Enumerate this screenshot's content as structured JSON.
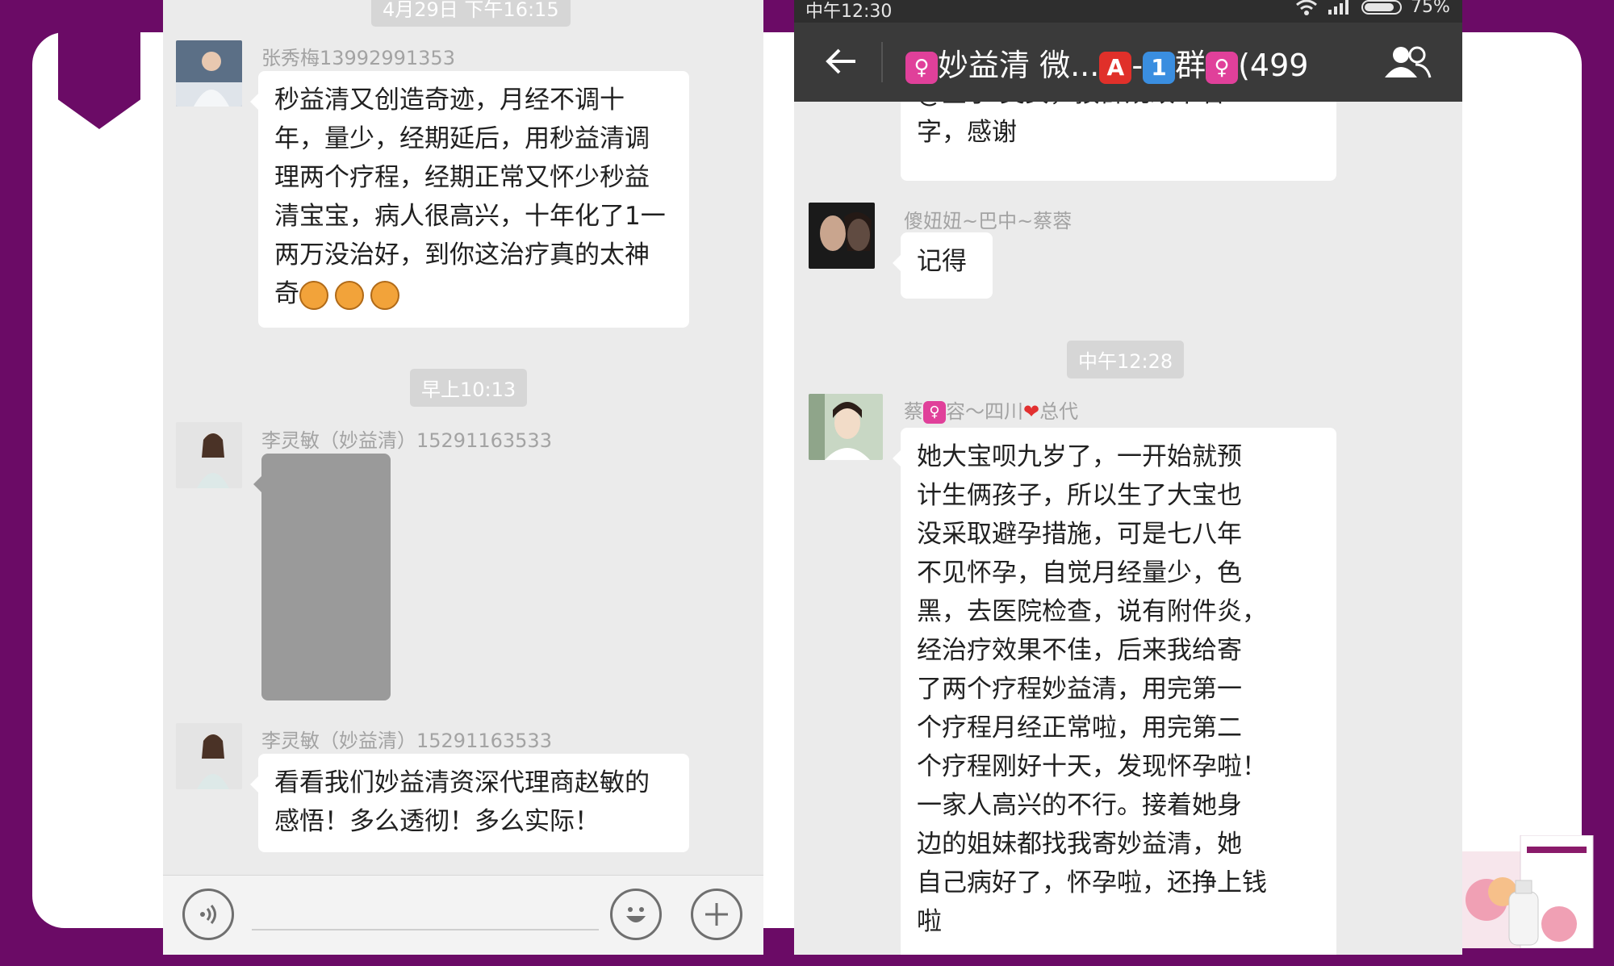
{
  "left_chat": {
    "top_timestamp": "4月29日 下午16:15",
    "messages": [
      {
        "sender": "张秀梅13992991353",
        "lines": [
          "秒益清又创造奇迹，月经不调十",
          "年，量少，经期延后，用秒益清调",
          "理两个疗程，经期正常又怀少秒益",
          "清宝宝，病人很高兴，十年化了1一",
          "两万没治好，到你这治疗真的太神",
          "奇"
        ]
      },
      {
        "timestamp": "早上10:13"
      },
      {
        "sender": "李灵敏（妙益清）15291163533",
        "type": "image"
      },
      {
        "sender": "李灵敏（妙益清）15291163533",
        "lines": [
          "看看我们妙益清资深代理商赵敏的",
          "感悟！多么透彻！多么实际！"
        ]
      }
    ],
    "input_bar": {
      "voice_icon": "voice-icon",
      "emoji_icon": "emoji-icon",
      "plus_icon": "plus-icon"
    }
  },
  "right_chat": {
    "status": {
      "time": "中午12:30",
      "battery": "75%"
    },
    "title": {
      "part1": "妙益清 微...",
      "tag_a": "A",
      "dash": "-",
      "tag_1": "1",
      "part2": "群",
      "count": "(499"
    },
    "partial_message": {
      "line_top": "@金子  美女，按群规改下名",
      "line_bottom": "字，感谢"
    },
    "messages": [
      {
        "sender": "傻妞妞~巴中~蔡蓉",
        "lines": [
          "记得"
        ]
      },
      {
        "timestamp": "中午12:28"
      },
      {
        "sender_prefix": "蔡",
        "sender_mid": "容～四川",
        "sender_suffix": "总代",
        "lines": [
          "她大宝呗九岁了，一开始就预",
          "计生俩孩子，所以生了大宝也",
          "没采取避孕措施，可是七八年",
          "不见怀孕，自觉月经量少，色",
          "黑，去医院检查，说有附件炎，",
          "经治疗效果不佳，后来我给寄",
          "了两个疗程妙益清，用完第一",
          "个疗程月经正常啦，用完第二",
          "个疗程刚好十天，发现怀孕啦！",
          "一家人高兴的不行。接着她身",
          "边的姐妹都找我寄妙益清，她",
          "自己病好了，怀孕啦，还挣上钱",
          "啦"
        ]
      }
    ]
  },
  "colors": {
    "frame": "#6b0b66",
    "chat_bg": "#ebebeb",
    "bubble": "#ffffff",
    "header": "#3a3a3a"
  }
}
